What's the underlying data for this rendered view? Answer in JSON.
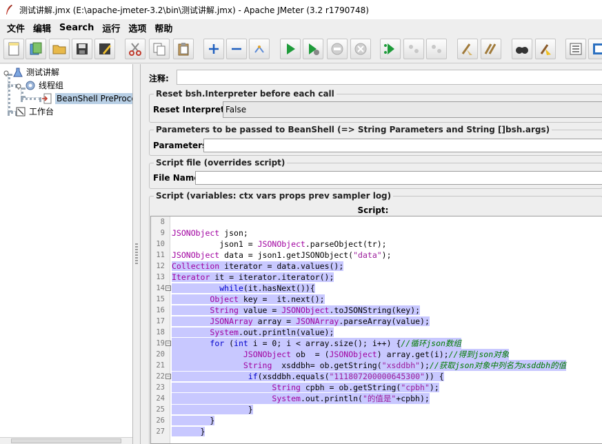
{
  "window": {
    "title": "测试讲解.jmx (E:\\apache-jmeter-3.2\\bin\\测试讲解.jmx) - Apache JMeter (3.2 r1790748)"
  },
  "menu": [
    "文件",
    "编辑",
    "Search",
    "运行",
    "选项",
    "帮助"
  ],
  "toolbar": {
    "icons": [
      "new-icon",
      "templates-icon",
      "open-icon",
      "save-icon",
      "save-as-icon",
      "cut-icon",
      "copy-icon",
      "paste-icon",
      "expand-icon",
      "collapse-icon",
      "toggle-icon",
      "start-icon",
      "start-no-pause-icon",
      "stop-icon",
      "shutdown-icon",
      "remote-start-icon",
      "remote-stop-icon",
      "remote-shutdown-icon",
      "clear-icon",
      "clear-all-icon",
      "search-icon",
      "reset-search-icon",
      "function-helper-icon",
      "help-icon"
    ]
  },
  "tree": {
    "items": [
      {
        "label": "测试讲解",
        "icon": "test-plan-icon"
      },
      {
        "label": "线程组",
        "icon": "thread-group-icon"
      },
      {
        "label": "BeanShell PreProcessor",
        "icon": "beanshell-icon"
      },
      {
        "label": "工作台",
        "icon": "workbench-icon"
      }
    ]
  },
  "panel": {
    "comment_label": "注释:",
    "reset_group_title": "Reset bsh.Interpreter before each call",
    "reset_label": "Reset Interpreter:",
    "reset_value": "False",
    "params_group_title": "Parameters to be passed to BeanShell (=> String Parameters and String []bsh.args)",
    "params_label": "Parameters:",
    "file_group_title": "Script file (overrides script)",
    "file_label": "File Name:",
    "script_group_title": "Script (variables: ctx vars props prev sampler log)",
    "script_header": "Script:"
  },
  "code": {
    "lines": [
      {
        "n": "8",
        "fold": false,
        "html": ""
      },
      {
        "n": "9",
        "fold": false,
        "html": "       JSONObject json;"
      },
      {
        "n": "10",
        "fold": false,
        "html": "          json1 = JSONObject.parseObject(tr);"
      },
      {
        "n": "11",
        "fold": false,
        "html": "          JSONObject data = json1.getJSONObject(\"data\");"
      },
      {
        "n": "12",
        "fold": false,
        "html": "           Collection iterator = data.values();"
      },
      {
        "n": "13",
        "fold": false,
        "html": "           Iterator it = iterator.iterator();"
      },
      {
        "n": "14",
        "fold": true,
        "html": "          while(it.hasNext()){"
      },
      {
        "n": "15",
        "fold": false,
        "html": "        Object key =  it.next();"
      },
      {
        "n": "16",
        "fold": false,
        "html": "        String value = JSONObject.toJSONString(key);"
      },
      {
        "n": "17",
        "fold": false,
        "html": "        JSONArray array = JSONArray.parseArray(value);"
      },
      {
        "n": "18",
        "fold": false,
        "html": "        System.out.println(value);"
      },
      {
        "n": "19",
        "fold": true,
        "html": "        for (int i = 0; i < array.size(); i++) {//循环json数组"
      },
      {
        "n": "20",
        "fold": false,
        "html": "               JSONObject ob  = (JSONObject) array.get(i);//得到json对象"
      },
      {
        "n": "21",
        "fold": false,
        "html": "               String  xsddbh= ob.getString(\"xsddbh\");//获取json对象中列名为xsddbh的值"
      },
      {
        "n": "22",
        "fold": true,
        "html": "                if(xsddbh.equals(\"111807200000645300\")) {"
      },
      {
        "n": "23",
        "fold": false,
        "html": "                     String cpbh = ob.getString(\"cpbh\");"
      },
      {
        "n": "24",
        "fold": false,
        "html": "                     System.out.println(\"的值是\"+cpbh);"
      },
      {
        "n": "25",
        "fold": false,
        "html": "                }"
      },
      {
        "n": "26",
        "fold": false,
        "html": "        }"
      },
      {
        "n": "27",
        "fold": false,
        "html": "      }"
      }
    ]
  }
}
